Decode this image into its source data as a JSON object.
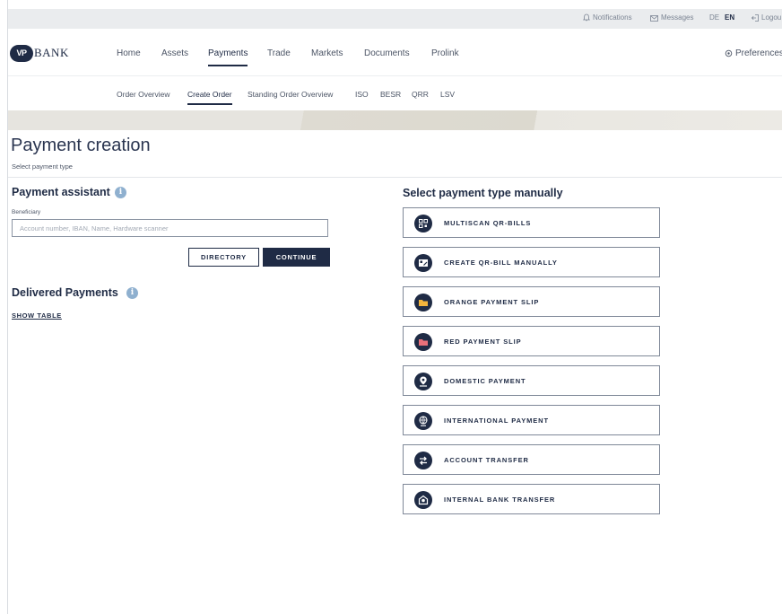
{
  "topbar": {
    "notifications": "Notifications",
    "messages": "Messages",
    "lang_de": "DE",
    "lang_en": "EN",
    "logout": "Logou"
  },
  "header": {
    "logo_badge": "VP",
    "logo_text": "BANK",
    "nav": [
      "Home",
      "Assets",
      "Payments",
      "Trade",
      "Markets",
      "Documents",
      "Prolink"
    ],
    "active_nav": "Payments",
    "preferences": "Preferences"
  },
  "subnav": {
    "items": [
      "Order Overview",
      "Create Order",
      "Standing Order Overview",
      "ISO",
      "BESR",
      "QRR",
      "LSV"
    ],
    "active": "Create Order"
  },
  "page": {
    "title": "Payment creation",
    "subtitle": "Select payment type"
  },
  "assistant": {
    "title": "Payment assistant",
    "info_glyph": "i",
    "field_label": "Beneficiary",
    "placeholder": "Account number, IBAN, Name, Hardware scanner",
    "value": "",
    "directory_button": "DIRECTORY",
    "continue_button": "CONTINUE"
  },
  "delivered": {
    "title": "Delivered Payments",
    "show_table": "SHOW TABLE"
  },
  "manual": {
    "title": "Select payment type manually",
    "types": [
      {
        "label": "MULTISCAN QR-BILLS",
        "icon": "qr-scan-icon",
        "accent": "#1f2b45"
      },
      {
        "label": "CREATE QR-BILL MANUALLY",
        "icon": "qr-edit-icon",
        "accent": "#1f2b45"
      },
      {
        "label": "ORANGE PAYMENT SLIP",
        "icon": "orange-slip-icon",
        "accent": "#f2b43d"
      },
      {
        "label": "RED PAYMENT SLIP",
        "icon": "red-slip-icon",
        "accent": "#e8707a"
      },
      {
        "label": "DOMESTIC PAYMENT",
        "icon": "location-pin-icon",
        "accent": "#1f2b45"
      },
      {
        "label": "INTERNATIONAL PAYMENT",
        "icon": "globe-icon",
        "accent": "#1f2b45"
      },
      {
        "label": "ACCOUNT TRANSFER",
        "icon": "transfer-arrows-icon",
        "accent": "#1f2b45"
      },
      {
        "label": "INTERNAL BANK TRANSFER",
        "icon": "bank-building-icon",
        "accent": "#1f2b45"
      }
    ]
  },
  "colors": {
    "primary": "#1f2b45",
    "info": "#8fb0cf",
    "border": "#7f8898"
  }
}
